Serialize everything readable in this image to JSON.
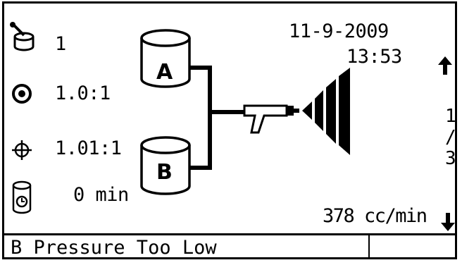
{
  "left_panel": {
    "recipe": "1",
    "mix_ratio": "1.0:1",
    "actual_ratio": "1.01:1",
    "pot_life": "0 min"
  },
  "components": {
    "a_label": "A",
    "b_label": "B"
  },
  "header": {
    "date": "11-9-2009",
    "time": "13:53"
  },
  "pager": {
    "current": "1",
    "sep": "/",
    "total": "3"
  },
  "flow_rate": "378 cc/min",
  "status": {
    "message": "B Pressure Too Low",
    "cell": ""
  },
  "icons": {
    "recipe": "recipe-icon",
    "ratio": "ratio-target-icon",
    "actual_ratio": "crosshair-icon",
    "pot_life": "pot-life-timer-icon",
    "up": "up-arrow-icon",
    "down": "down-arrow-icon",
    "gun": "spray-gun-icon",
    "spray": "spray-pattern-icon"
  }
}
